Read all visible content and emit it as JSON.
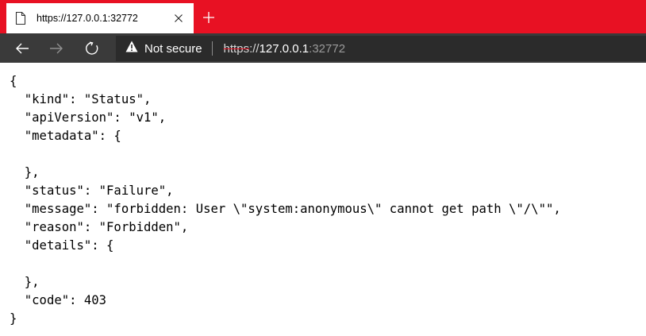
{
  "browser": {
    "tab": {
      "title": "https://127.0.0.1:32772",
      "icon": "page-icon",
      "close_icon": "close-icon"
    },
    "new_tab_icon": "plus-icon",
    "accent_color": "#e81123",
    "toolbar": {
      "back_icon": "arrow-left-icon",
      "forward_icon": "arrow-right-icon",
      "refresh_icon": "refresh-icon",
      "security_icon": "warning-icon",
      "security_label": "Not secure",
      "url": {
        "scheme": "https",
        "separator": "://",
        "host": "127.0.0.1",
        "port": ":32772"
      }
    }
  },
  "page": {
    "lines": [
      "{",
      "  \"kind\": \"Status\",",
      "  \"apiVersion\": \"v1\",",
      "  \"metadata\": {",
      "",
      "  },",
      "  \"status\": \"Failure\",",
      "  \"message\": \"forbidden: User \\\"system:anonymous\\\" cannot get path \\\"/\\\"\",",
      "  \"reason\": \"Forbidden\",",
      "  \"details\": {",
      "",
      "  },",
      "  \"code\": 403",
      "}"
    ]
  }
}
